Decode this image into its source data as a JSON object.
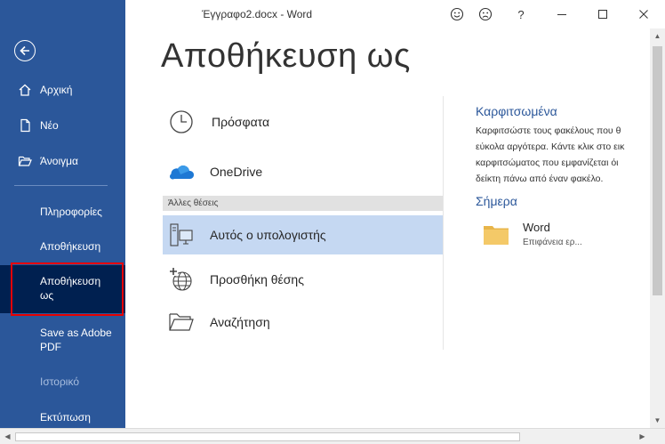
{
  "window": {
    "title": "Έγγραφο2.docx  -  Word",
    "help_label": "?"
  },
  "sidebar": {
    "back_icon": "back-arrow-icon",
    "items": [
      {
        "label": "Αρχική",
        "icon": "home-icon"
      },
      {
        "label": "Νέο",
        "icon": "new-document-icon"
      },
      {
        "label": "Άνοιγμα",
        "icon": "open-folder-icon"
      },
      {
        "label": "Πληροφορίες"
      },
      {
        "label": "Αποθήκευση"
      },
      {
        "label": "Αποθήκευση ως",
        "selected": true
      },
      {
        "label": "Save as Adobe PDF"
      },
      {
        "label": "Ιστορικό",
        "disabled": true
      },
      {
        "label": "Εκτύπωση"
      }
    ]
  },
  "main": {
    "heading": "Αποθήκευση ως",
    "locations": [
      {
        "label": "Πρόσφατα",
        "icon": "clock-icon"
      },
      {
        "label": "OneDrive",
        "icon": "onedrive-cloud-icon"
      }
    ],
    "other_places_header": "Άλλες θέσεις",
    "other_places": [
      {
        "label": "Αυτός ο υπολογιστής",
        "icon": "this-pc-icon",
        "selected": true
      },
      {
        "label": "Προσθήκη θέσης",
        "icon": "add-place-icon"
      },
      {
        "label": "Αναζήτηση",
        "icon": "browse-folder-icon"
      }
    ]
  },
  "right_panel": {
    "pinned_title": "Καρφιτσωμένα",
    "pinned_description_lines": [
      "Καρφιτσώστε τους φακέλους που θ",
      "εύκολα αργότερα. Κάντε κλικ στο εικ",
      "καρφιτσώματος που εμφανίζεται όι",
      "δείκτη πάνω από έναν φακέλο."
    ],
    "today_title": "Σήμερα",
    "folders": [
      {
        "name": "Word",
        "path": "Επιφάνεια ερ..."
      }
    ]
  },
  "colors": {
    "sidebar_bg": "#2b579a",
    "sidebar_selected_bg": "#002050",
    "selection_outline": "#e60000",
    "accent_text": "#2b579a",
    "selected_location_bg": "#c5d8f2"
  }
}
